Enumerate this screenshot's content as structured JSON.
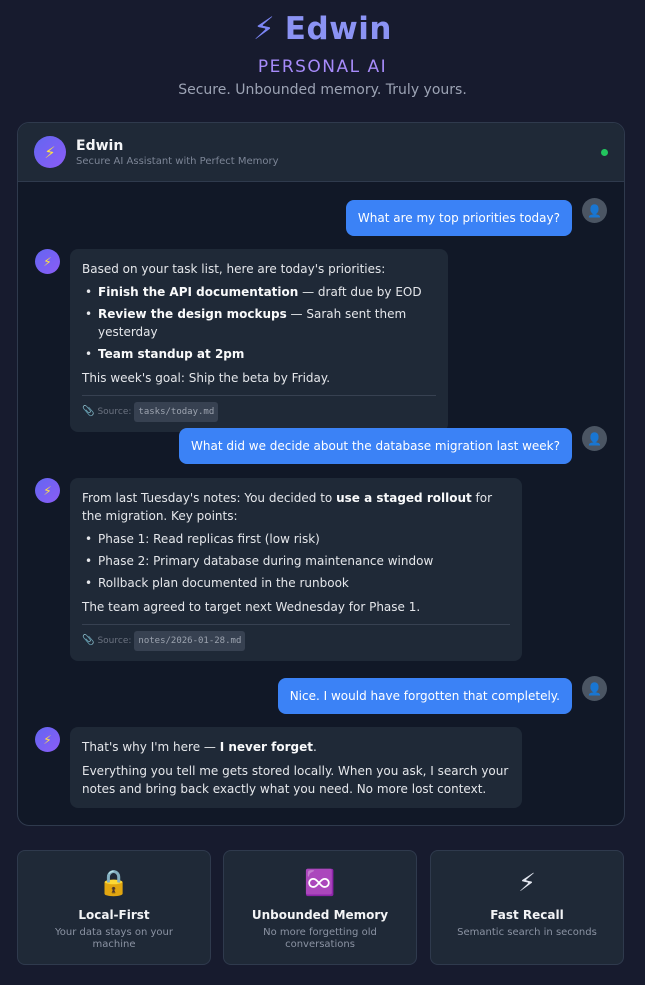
{
  "hero": {
    "icon": "lightning-icon",
    "title": "Edwin",
    "subtitle": "PERSONAL AI",
    "tagline": "Secure. Unbounded memory. Truly yours."
  },
  "chat": {
    "header": {
      "name": "Edwin",
      "description": "Secure AI Assistant with Perfect Memory",
      "status_color": "#22c55e"
    },
    "messages": [
      {
        "role": "user",
        "text": "What are my top priorities today?"
      },
      {
        "role": "assistant",
        "intro": "Based on your task list, here are today's priorities:",
        "items": [
          {
            "bold": "Finish the API documentation",
            "rest": " — draft due by EOD"
          },
          {
            "bold": "Review the design mockups",
            "rest": " — Sarah sent them yesterday"
          },
          {
            "bold": "Team standup at 2pm",
            "rest": ""
          }
        ],
        "outro": "This week's goal: Ship the beta by Friday.",
        "source_label": "Source:",
        "source_file": "tasks/today.md"
      },
      {
        "role": "user",
        "text": "What did we decide about the database migration last week?"
      },
      {
        "role": "assistant",
        "intro_pre": "From last Tuesday's notes: You decided to ",
        "intro_bold": "use a staged rollout",
        "intro_post": " for the migration. Key points:",
        "items": [
          "Phase 1: Read replicas first (low risk)",
          "Phase 2: Primary database during maintenance window",
          "Rollback plan documented in the runbook"
        ],
        "outro": "The team agreed to target next Wednesday for Phase 1.",
        "source_label": "Source:",
        "source_file": "notes/2026-01-28.md"
      },
      {
        "role": "user",
        "text": "Nice. I would have forgotten that completely."
      },
      {
        "role": "assistant",
        "line1_pre": "That's why I'm here — ",
        "line1_bold": "I never forget",
        "line1_post": ".",
        "line2": "Everything you tell me gets stored locally. When you ask, I search your notes and bring back exactly what you need. No more lost context."
      }
    ]
  },
  "features": [
    {
      "icon": "lock-icon",
      "glyph": "🔒",
      "title": "Local-First",
      "description": "Your data stays on your machine"
    },
    {
      "icon": "infinity-icon",
      "glyph": "♾️",
      "title": "Unbounded Memory",
      "description": "No more forgetting old conversations"
    },
    {
      "icon": "lightning-icon",
      "glyph": "⚡",
      "title": "Fast Recall",
      "description": "Semantic search in seconds"
    }
  ],
  "colors": {
    "accent": "#8b93f4",
    "subtitle": "#a78bfa",
    "user_bubble": "#3b82f6",
    "bot_bubble": "#1f2937",
    "background": "#171b2e"
  }
}
